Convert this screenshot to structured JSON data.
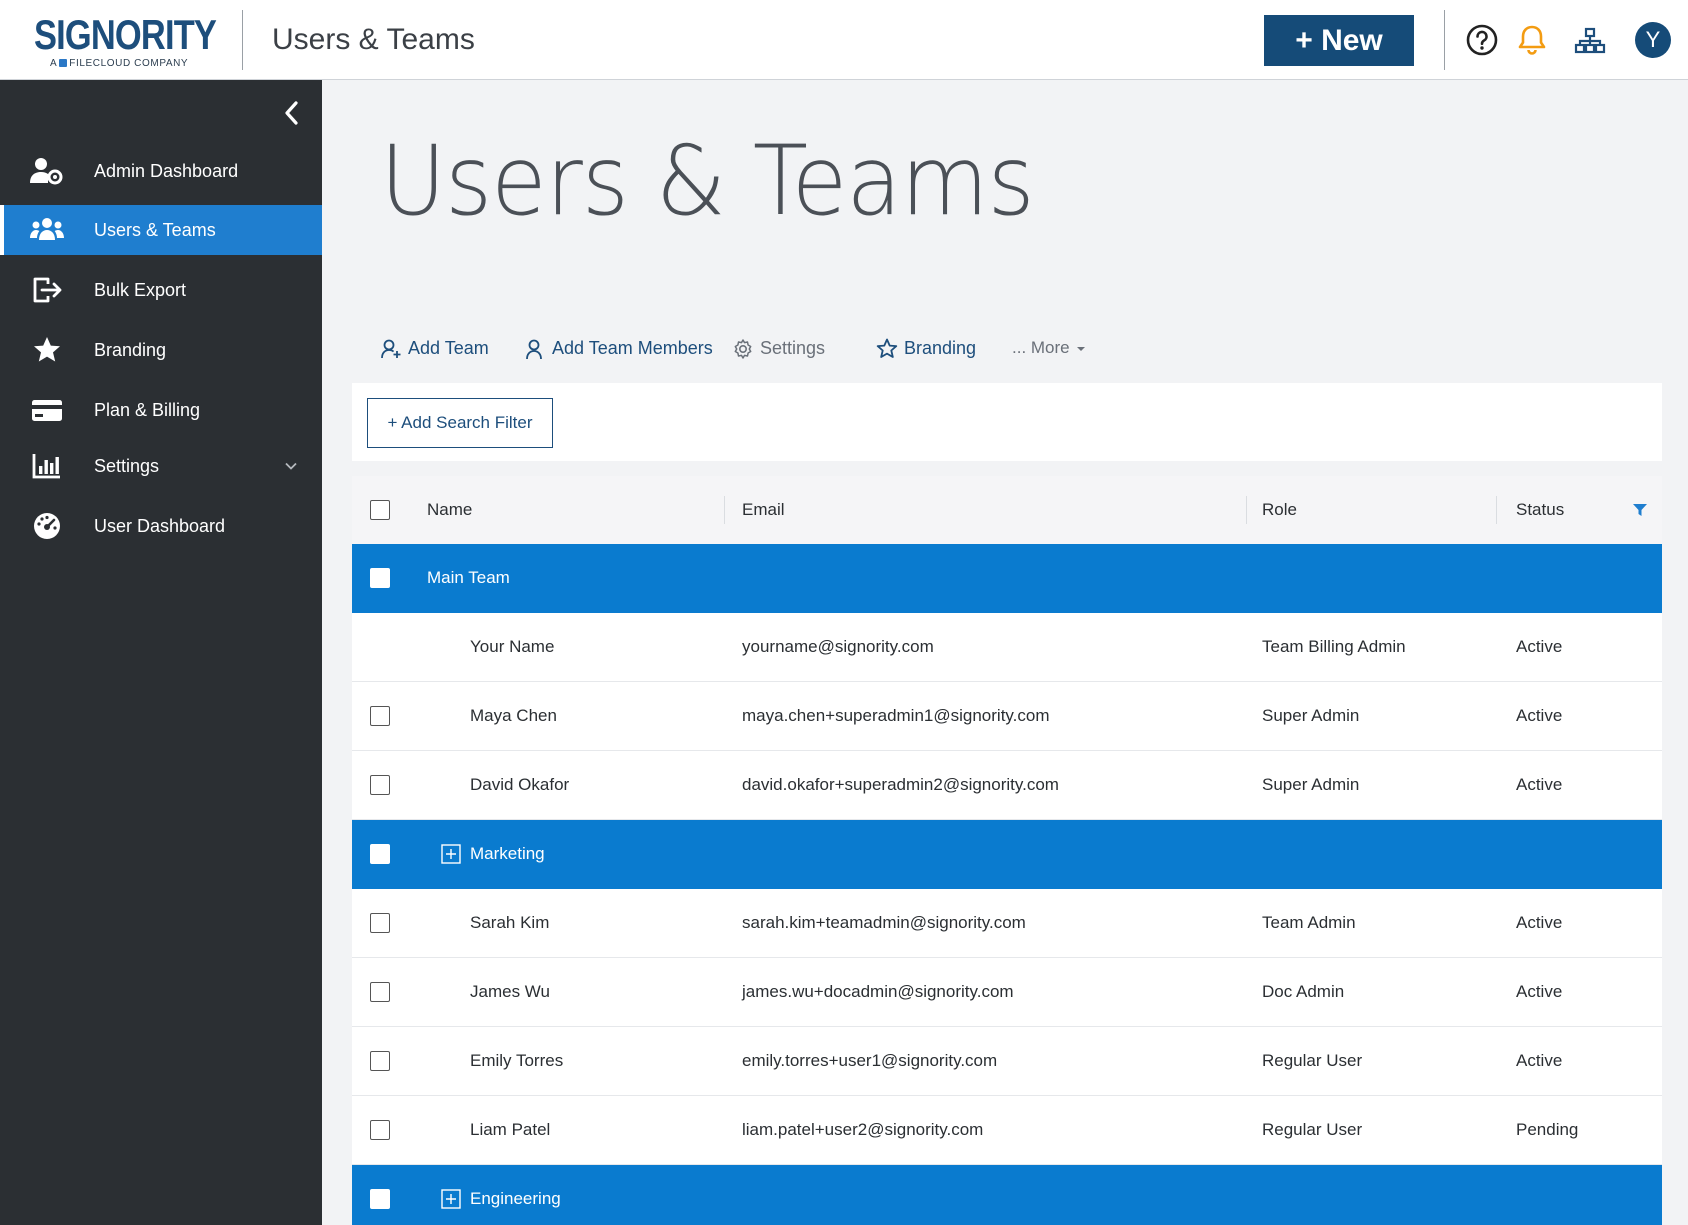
{
  "header": {
    "logo_word": "SIGNORITY",
    "logo_sub_pre": "A",
    "logo_sub_post": "FILECLOUD COMPANY",
    "title": "Users & Teams",
    "new_button": "+ New",
    "avatar_initial": "Y",
    "icons": [
      "help-circle-icon",
      "bell-icon",
      "org-chart-icon"
    ],
    "bell_color": "#f39c12"
  },
  "sidebar": {
    "items": [
      {
        "label": "Admin Dashboard",
        "icon": "user-gear-icon",
        "active": false
      },
      {
        "label": "Users & Teams",
        "icon": "users-icon",
        "active": true
      },
      {
        "label": "Bulk Export",
        "icon": "export-icon",
        "active": false
      },
      {
        "label": "Branding",
        "icon": "star-icon",
        "active": false
      },
      {
        "label": "Plan & Billing",
        "icon": "credit-card-icon",
        "active": false
      },
      {
        "label": "Settings",
        "icon": "bar-chart-icon",
        "active": false
      },
      {
        "label": "User Dashboard",
        "icon": "dashboard-gauge-icon",
        "active": false
      }
    ]
  },
  "main": {
    "page_title": "Users & Teams",
    "toolbar": {
      "add_team": "Add Team",
      "add_team_members": "Add Team Members",
      "settings": "Settings",
      "branding": "Branding",
      "more": "... More"
    },
    "filter_button": "+ Add Search Filter",
    "table": {
      "headers": {
        "name": "Name",
        "email": "Email",
        "role": "Role",
        "status": "Status"
      },
      "rows": [
        {
          "type": "team",
          "name": "Main Team"
        },
        {
          "type": "user",
          "name": "Your Name",
          "email": "yourname@signority.com",
          "role": "Team Billing Admin",
          "status": "Active"
        },
        {
          "type": "user",
          "name": "Maya Chen",
          "email": "maya.chen+superadmin1@signority.com",
          "role": "Super Admin",
          "status": "Active"
        },
        {
          "type": "user",
          "name": "David Okafor",
          "email": "david.okafor+superadmin2@signority.com",
          "role": "Super Admin",
          "status": "Active"
        },
        {
          "type": "team",
          "name": "Marketing"
        },
        {
          "type": "user",
          "name": "Sarah Kim",
          "email": "sarah.kim+teamadmin@signority.com",
          "role": "Team Admin",
          "status": "Active"
        },
        {
          "type": "user",
          "name": "James Wu",
          "email": "james.wu+docadmin@signority.com",
          "role": "Doc Admin",
          "status": "Active"
        },
        {
          "type": "user",
          "name": "Emily Torres",
          "email": "emily.torres+user1@signority.com",
          "role": "Regular User",
          "status": "Active"
        },
        {
          "type": "user",
          "name": "Liam Patel",
          "email": "liam.patel+user2@signority.com",
          "role": "Regular User",
          "status": "Pending"
        },
        {
          "type": "team",
          "name": "Engineering"
        }
      ]
    }
  },
  "colors": {
    "brand_dark": "#154b78",
    "sidebar_bg": "#2b2f33",
    "active_blue": "#1f7ecf",
    "team_row_blue": "#0a7bcf"
  }
}
